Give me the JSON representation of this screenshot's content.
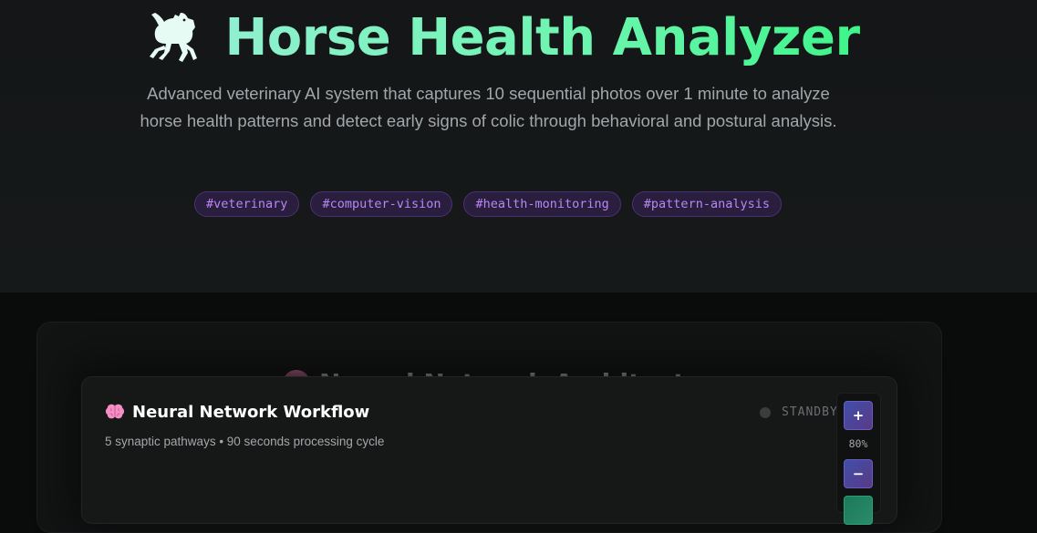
{
  "hero": {
    "icon": "horse-icon",
    "title": "Horse Health Analyzer",
    "subtitle": "Advanced veterinary AI system that captures 10 sequential photos over 1 minute to analyze horse health patterns and detect early signs of colic through behavioral and postural analysis.",
    "tags": [
      "#veterinary",
      "#computer-vision",
      "#health-monitoring",
      "#pattern-analysis"
    ]
  },
  "architecture": {
    "heading": "Neural Network Architecture"
  },
  "workflow": {
    "icon": "brain-icon",
    "title": "Neural Network Workflow",
    "subtitle": "5 synaptic pathways • 90 seconds processing cycle",
    "status": "STANDBY",
    "zoom": {
      "in_label": "+",
      "level": "80%",
      "out_label": "−"
    }
  },
  "colors": {
    "title_gradient_start": "#8ff0d0",
    "title_gradient_end": "#3ef58a",
    "tag_text": "#b987f4",
    "tag_bg": "#2a1e3e",
    "status_dot": "#3a3c3e"
  }
}
